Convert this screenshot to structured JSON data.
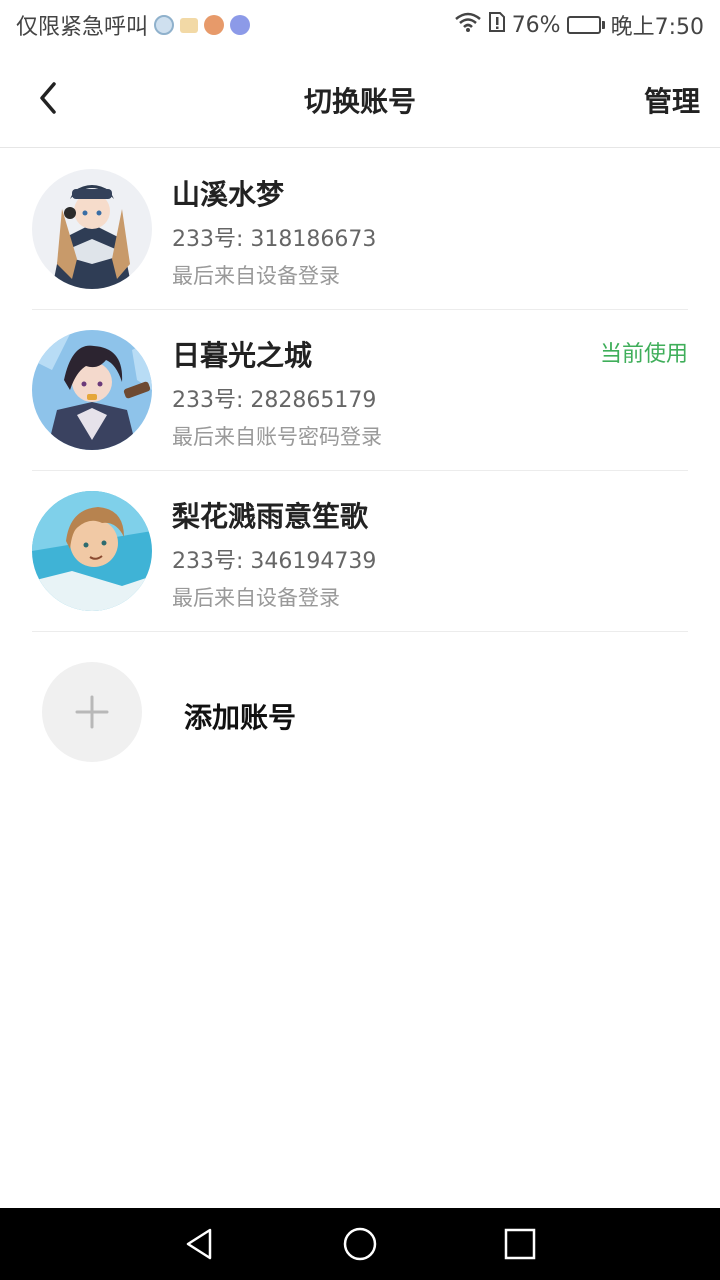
{
  "status_bar": {
    "carrier_text": "仅限紧急呼叫",
    "battery_percent": "76%",
    "battery_level": 0.76,
    "time": "晚上7:50",
    "icons": [
      "app-notify-icon",
      "folder-icon",
      "cookie-icon",
      "music-icon",
      "wifi-icon",
      "alert-sim-icon",
      "battery-icon"
    ]
  },
  "header": {
    "title": "切换账号",
    "manage_label": "管理",
    "back_icon": "chevron-left-icon"
  },
  "accounts": [
    {
      "name": "山溪水梦",
      "id": "233号: 318186673",
      "login": "最后来自设备登录",
      "current": ""
    },
    {
      "name": "日暮光之城",
      "id": "233号: 282865179",
      "login": "最后来自账号密码登录",
      "current": "当前使用"
    },
    {
      "name": "梨花溅雨意笙歌",
      "id": "233号: 346194739",
      "login": "最后来自设备登录",
      "current": ""
    }
  ],
  "add_account": {
    "label": "添加账号",
    "icon": "plus-icon"
  },
  "colors": {
    "current_tag": "#3fae5a",
    "divider": "#ececec",
    "nav_bar": "#000000"
  },
  "nav_bar": {
    "icons": [
      "back-triangle-icon",
      "home-circle-icon",
      "recents-square-icon"
    ]
  }
}
